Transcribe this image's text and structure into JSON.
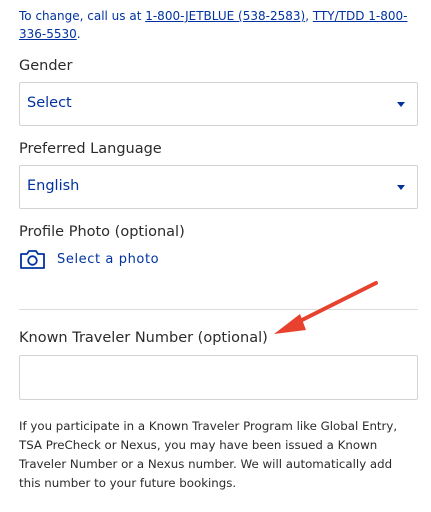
{
  "contact": {
    "prefix": "To change, call us at ",
    "phone_link": "1-800-JETBLUE (538-2583)",
    "separator": ", ",
    "tty_link": "TTY/TDD 1-800-336-5530",
    "suffix": "."
  },
  "gender": {
    "label": "Gender",
    "value": "Select"
  },
  "language": {
    "label": "Preferred Language",
    "value": "English"
  },
  "photo": {
    "label": "Profile Photo (optional)",
    "action": "Select a photo",
    "icon": "camera-icon"
  },
  "ktn": {
    "label": "Known Traveler Number (optional)",
    "value": "",
    "help": "If you participate in a Known Traveler Program like Global Entry, TSA PreCheck or Nexus, you may have been issued a Known Traveler Number or a Nexus number. We will automatically add this number to your future bookings."
  },
  "colors": {
    "accent": "#0033a0",
    "annotation": "#e8422f",
    "border": "#d3d3d3"
  }
}
